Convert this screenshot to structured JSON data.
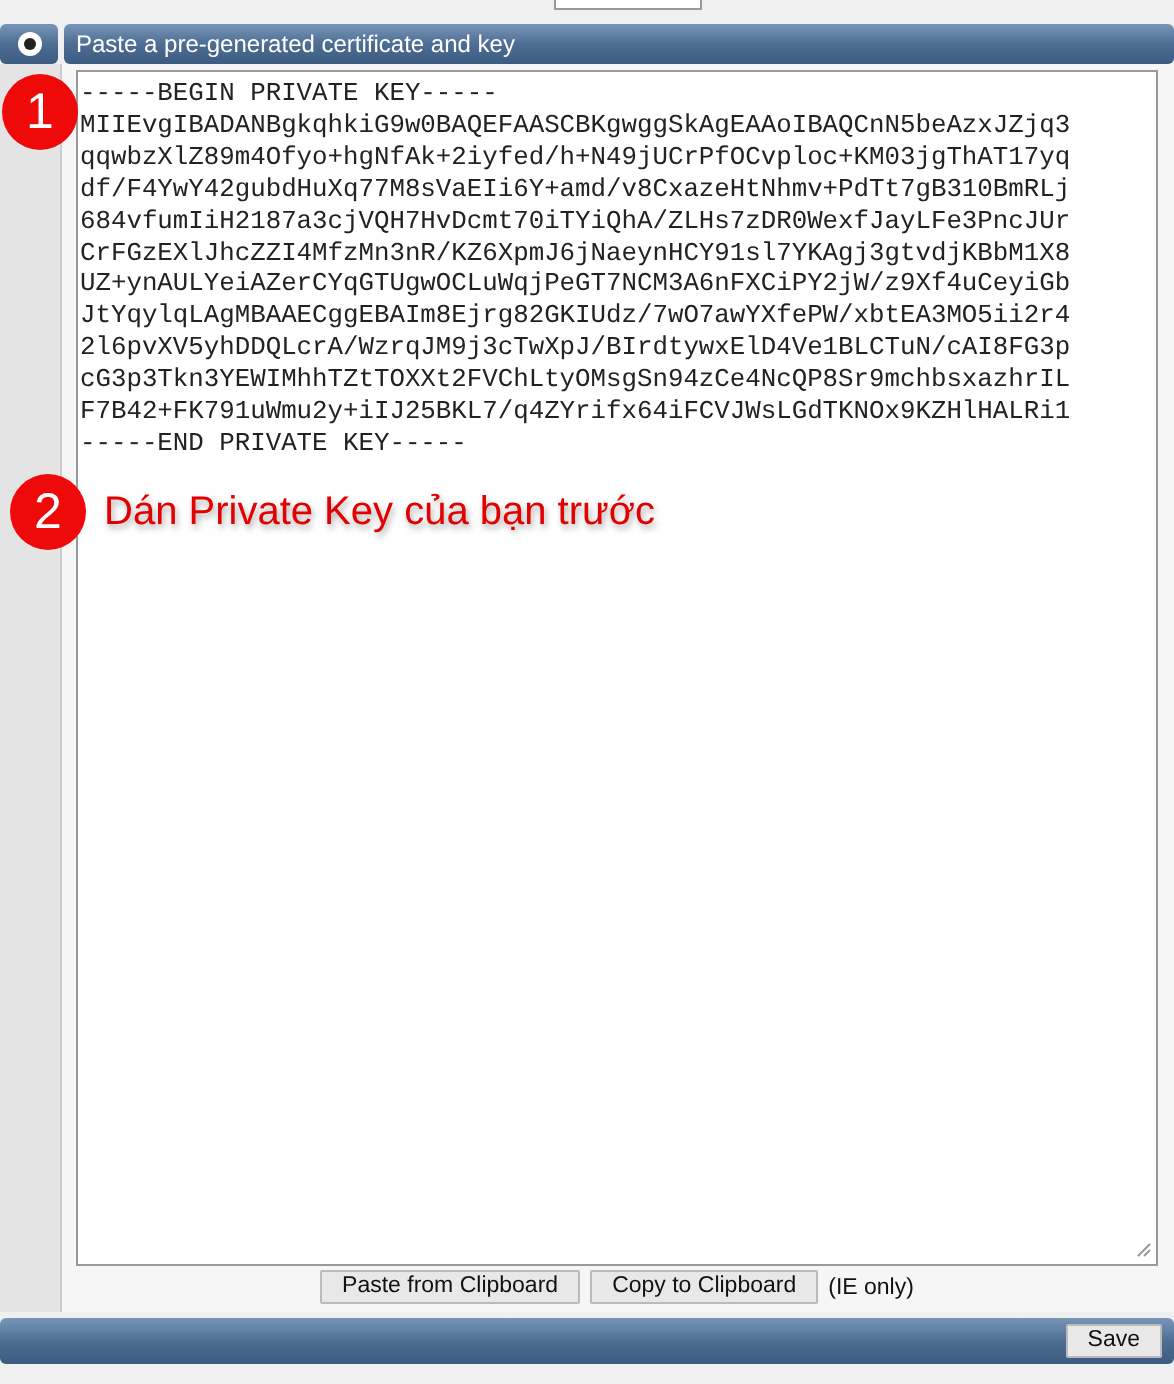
{
  "section": {
    "title": "Paste a pre-generated certificate and key",
    "selected": true
  },
  "key_lines": [
    "-----BEGIN PRIVATE KEY-----",
    "MIIEvgIBADANBgkqhkiG9w0BAQEFAASCBKgwggSkAgEAAoIBAQCnN5beAzxJZjq3",
    "qqwbzXlZ89m4Ofyo+hgNfAk+2iyfed/h+N49jUCrPfOCvploc+KM03jgThAT17yq",
    "df/F4YwY42gubdHuXq77M8sVaEIi6Y+amd/v8CxazeHtNhmv+PdTt7gB310BmRLj",
    "684vfumIiH2187a3cjVQH7HvDcmt70iTYiQhA/ZLHs7zDR0WexfJayLFe3PncJUr",
    "CrFGzEXlJhcZZI4MfzMn3nR/KZ6XpmJ6jNaeynHCY91sl7YKAgj3gtvdjKBbM1X8",
    "UZ+ynAULYeiAZerCYqGTUgwOCLuWqjPeGT7NCM3A6nFXCiPY2jW/z9Xf4uCeyiGb",
    "JtYqylqLAgMBAAECggEBAIm8Ejrg82GKIUdz/7wO7awYXfePW/xbtEA3MO5ii2r4",
    "2l6pvXV5yhDDQLcrA/WzrqJM9j3cTwXpJ/BIrdtywxElD4Ve1BLCTuN/cAI8FG3p",
    "cG3p3Tkn3YEWIMhhTZtTOXXt2FVChLtyOMsgSn94zCe4NcQP8Sr9mchbsxazhrIL",
    "F7B42+FK791uWmu2y+iIJ25BKL7/q4ZYrifx64iFCVJWsLGdTKNOx9KZHlHALRi1",
    "-----END PRIVATE KEY-----"
  ],
  "annotations": [
    {
      "number": "1"
    },
    {
      "number": "2",
      "text": "Dán Private Key của bạn trước"
    }
  ],
  "clipboard_buttons": [
    "Paste from Clipboard",
    "Copy to Clipboard"
  ],
  "clipboard_note": "(IE only)",
  "save_button": "Save"
}
